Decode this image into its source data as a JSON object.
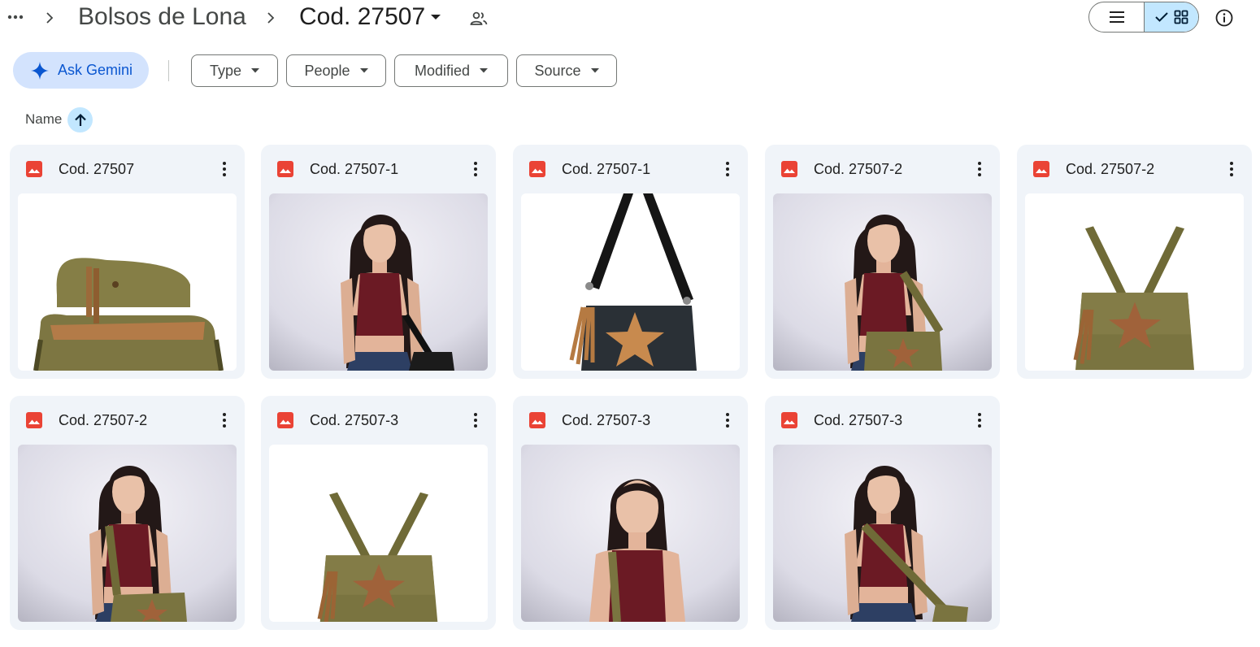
{
  "breadcrumb": {
    "more_icon": "more-horiz-icon",
    "parent": "Bolsos de Lona",
    "current": "Cod. 27507",
    "shared_icon": "people-icon"
  },
  "toolbar": {
    "list_view_icon": "list-icon",
    "grid_view_icons": [
      "check-icon",
      "grid-icon"
    ],
    "info_icon": "info-icon"
  },
  "filters": {
    "ask_gemini": "Ask Gemini",
    "chips": [
      {
        "label": "Type"
      },
      {
        "label": "People"
      },
      {
        "label": "Modified"
      },
      {
        "label": "Source"
      }
    ]
  },
  "sort": {
    "label": "Name",
    "direction_icon": "arrow-up-icon"
  },
  "files": [
    {
      "name": "Cod. 27507",
      "thumb": "olive canvas bag open, close-up"
    },
    {
      "name": "Cod. 27507-1",
      "thumb": "woman in maroon top with black bag"
    },
    {
      "name": "Cod. 27507-1",
      "thumb": "black bag with tan star"
    },
    {
      "name": "Cod. 27507-2",
      "thumb": "woman with olive bag"
    },
    {
      "name": "Cod. 27507-2",
      "thumb": "olive bag with tan star"
    },
    {
      "name": "Cod. 27507-2",
      "thumb": "woman with olive bag, front"
    },
    {
      "name": "Cod. 27507-3",
      "thumb": "olive bag with star, hanging"
    },
    {
      "name": "Cod. 27507-3",
      "thumb": "woman portrait in maroon top"
    },
    {
      "name": "Cod. 27507-3",
      "thumb": "woman with olive bag, side"
    }
  ],
  "colors": {
    "accent_chip": "#d3e3fd",
    "accent_text": "#0b57d0",
    "selected_toggle": "#c2e7ff",
    "card_bg": "#f0f4f9",
    "image_icon": "#ea4335"
  }
}
